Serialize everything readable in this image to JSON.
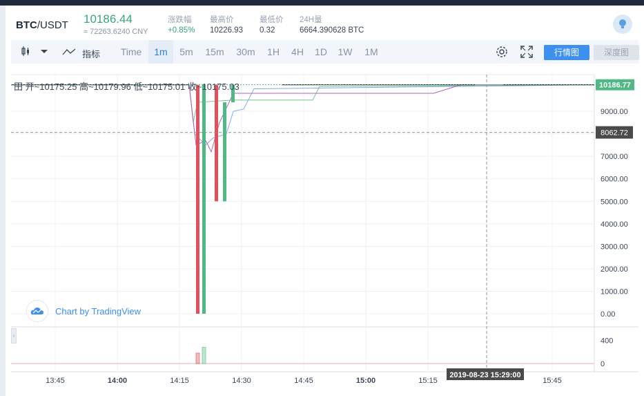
{
  "ticker": {
    "pair_base": "BTC",
    "pair_quote": "/USDT",
    "last_price": "10186.44",
    "cny_equiv": "≈ 72263.6240 CNY",
    "stats": [
      {
        "label": "涨跌幅",
        "value": "+0.85%",
        "up": true
      },
      {
        "label": "最高价",
        "value": "10226.93",
        "up": false
      },
      {
        "label": "最低价",
        "value": "0.32",
        "up": false
      },
      {
        "label": "24H量",
        "value": "6664.390628 BTC",
        "up": false
      }
    ]
  },
  "toolbar": {
    "indicators_label": "指标",
    "intervals": [
      "Time",
      "1m",
      "5m",
      "15m",
      "30m",
      "1H",
      "4H",
      "1D",
      "1W",
      "1M"
    ],
    "active_interval": "1m",
    "market_button": "行情图",
    "depth_button": "深度图"
  },
  "legend": {
    "text": "开~10175.25  高~10179.96  低~10175.01  收~10175.03"
  },
  "watermark": "Chart by TradingView",
  "chart_data": {
    "type": "candlestick",
    "price_axis_ticks": [
      "9000.00",
      "8000.00",
      "7000.00",
      "6000.00",
      "5000.00",
      "4000.00",
      "3000.00",
      "2000.00",
      "1000.00",
      "0.00"
    ],
    "volume_axis_ticks": [
      "400",
      "0"
    ],
    "time_axis_ticks": [
      "13:45",
      "14:00",
      "14:15",
      "14:30",
      "14:45",
      "15:00",
      "15:15",
      "15:45"
    ],
    "last_price_label": "10186.77",
    "crosshair_price_label": "8062.72",
    "crosshair_time_label": "2019-08-23 15:29:00",
    "price_range": [
      0,
      10200
    ],
    "notable_candles": [
      {
        "time": "14:19",
        "open": 10175,
        "high": 10180,
        "low": 0.32,
        "close": 0,
        "direction": "down"
      },
      {
        "time": "14:20",
        "open": 0,
        "high": 10180,
        "low": 0,
        "close": 10180,
        "direction": "up"
      },
      {
        "time": "14:22",
        "open": 10180,
        "high": 10180,
        "low": 5000,
        "close": 5000,
        "direction": "down"
      },
      {
        "time": "14:23",
        "open": 5000,
        "high": 9400,
        "low": 5000,
        "close": 9400,
        "direction": "up"
      },
      {
        "time": "14:24",
        "open": 9400,
        "high": 10180,
        "low": 9400,
        "close": 10180,
        "direction": "up"
      }
    ],
    "volume_values": [
      {
        "time": "14:19",
        "value": 180
      },
      {
        "time": "14:20",
        "value": 280
      }
    ]
  }
}
